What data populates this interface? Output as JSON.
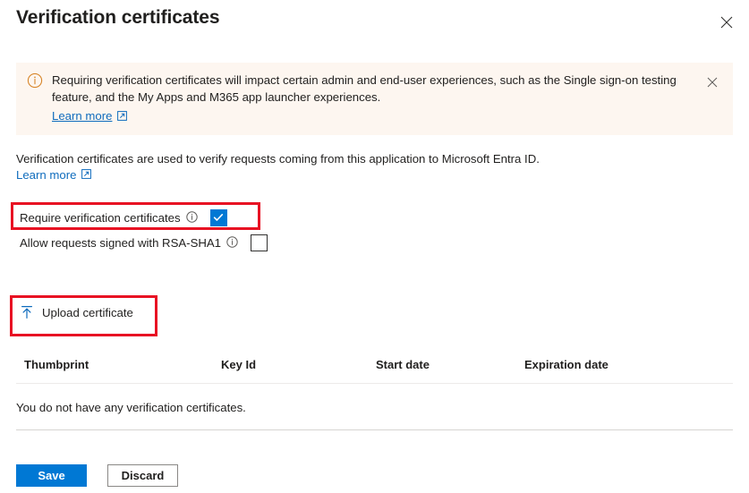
{
  "header": {
    "title": "Verification certificates",
    "close_icon": "close-icon"
  },
  "banner": {
    "icon": "info-circle-icon",
    "text": "Requiring verification certificates will impact certain admin and end-user experiences, such as the Single sign-on testing feature, and the My Apps and M365 app launcher experiences.",
    "link_label": "Learn more",
    "link_external_icon": "external-link-icon",
    "close_icon": "close-icon",
    "background_color": "#fdf6f0",
    "icon_color": "#d8862a"
  },
  "description": {
    "text": "Verification certificates are used to verify requests coming from this application to Microsoft Entra ID.",
    "link_label": "Learn more",
    "link_external_icon": "external-link-icon"
  },
  "options": [
    {
      "label": "Require verification certificates",
      "info_icon": "info-circle-icon",
      "checked": true,
      "highlighted": true
    },
    {
      "label": "Allow requests signed with RSA-SHA1",
      "info_icon": "info-circle-icon",
      "checked": false,
      "highlighted": false
    }
  ],
  "upload": {
    "label": "Upload certificate",
    "icon": "upload-arrow-icon",
    "highlighted": true
  },
  "table": {
    "columns": [
      "Thumbprint",
      "Key Id",
      "Start date",
      "Expiration date"
    ],
    "rows": [],
    "empty_text": "You do not have any verification certificates."
  },
  "footer": {
    "save_label": "Save",
    "discard_label": "Discard"
  },
  "colors": {
    "accent": "#0078d4",
    "link": "#0f6cbd",
    "annotation": "#e81123",
    "banner_bg": "#fdf6f0"
  }
}
